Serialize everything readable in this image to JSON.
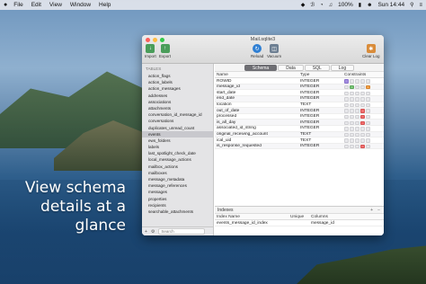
{
  "menubar": {
    "apple": "",
    "items": [
      "File",
      "Edit",
      "View",
      "Window",
      "Help"
    ],
    "battery": "100%",
    "clock": "Sun 14:44"
  },
  "tagline": [
    "View schema",
    "details at a",
    "glance"
  ],
  "window": {
    "title": "Mail.sqlite3",
    "toolbar": {
      "import": "Import",
      "export": "Export",
      "reload": "Reload",
      "vacuum": "Vacuum",
      "clear_log": "Clear Log"
    },
    "sidebar": {
      "header": "TABLES",
      "items": [
        "action_flags",
        "action_labels",
        "action_messages",
        "addresses",
        "associations",
        "attachments",
        "conversation_id_message_id",
        "conversations",
        "duplicates_unread_count",
        "events",
        "ews_folders",
        "labels",
        "last_spotlight_check_date",
        "local_message_actions",
        "mailbox_actions",
        "mailboxes",
        "message_metadata",
        "message_references",
        "messages",
        "properties",
        "recipients",
        "searchable_attachments"
      ],
      "selected": "events",
      "search_placeholder": "Search"
    },
    "tabs": [
      "Schema",
      "Data",
      "SQL",
      "Log"
    ],
    "active_tab": "Schema",
    "columns_table": {
      "headers": [
        "Name",
        "Type",
        "Constraints"
      ],
      "rows": [
        {
          "name": "ROWID",
          "type": "INTEGER",
          "c": [
            "pk",
            "",
            "",
            "",
            ""
          ]
        },
        {
          "name": "message_id",
          "type": "INTEGER",
          "c": [
            "",
            "nn",
            "",
            "",
            "df"
          ]
        },
        {
          "name": "start_date",
          "type": "INTEGER",
          "c": [
            "",
            "",
            "",
            "",
            ""
          ]
        },
        {
          "name": "end_date",
          "type": "INTEGER",
          "c": [
            "",
            "",
            "",
            "",
            ""
          ]
        },
        {
          "name": "location",
          "type": "TEXT",
          "c": [
            "",
            "",
            "",
            "",
            ""
          ]
        },
        {
          "name": "out_of_date",
          "type": "INTEGER",
          "c": [
            "",
            "",
            "",
            "rd",
            ""
          ]
        },
        {
          "name": "processed",
          "type": "INTEGER",
          "c": [
            "",
            "",
            "",
            "rd",
            ""
          ]
        },
        {
          "name": "is_all_day",
          "type": "INTEGER",
          "c": [
            "",
            "",
            "",
            "rd",
            ""
          ]
        },
        {
          "name": "associated_id_string",
          "type": "INTEGER",
          "c": [
            "",
            "",
            "",
            "",
            ""
          ]
        },
        {
          "name": "original_receiving_account",
          "type": "TEXT",
          "c": [
            "",
            "",
            "",
            "",
            ""
          ]
        },
        {
          "name": "ical_uid",
          "type": "TEXT",
          "c": [
            "",
            "",
            "",
            "",
            ""
          ]
        },
        {
          "name": "is_response_requested",
          "type": "INTEGER",
          "c": [
            "",
            "",
            "",
            "rd",
            ""
          ]
        }
      ]
    },
    "indexes": {
      "label": "Indexes",
      "headers": [
        "Index Name",
        "Unique",
        "Columns"
      ],
      "rows": [
        {
          "name": "events_message_id_index",
          "unique": "",
          "columns": "message_id"
        }
      ]
    }
  },
  "colors": {
    "accent": "#6e6e73",
    "pk": "#a58ee0",
    "nn": "#7cc77a",
    "df": "#f2a24a",
    "rd": "#f26f6f"
  }
}
